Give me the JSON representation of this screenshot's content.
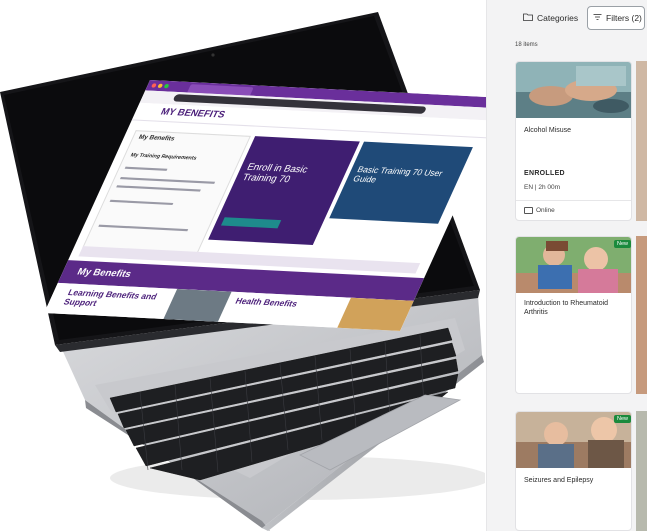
{
  "laptop_screen": {
    "page_title": "MY BENEFITS",
    "section_title": "My Benefits",
    "left_subtitle": "My Training Requirements",
    "card1_title": "Enroll in Basic Training 70",
    "card2_title": "Basic Training 70 User Guide",
    "band_title": "My Benefits",
    "bottom_left_title": "Learning Benefits and Support",
    "bottom_mid_title": "Health Benefits"
  },
  "toolbar": {
    "categories_label": "Categories",
    "filters_label": "Filters (2)",
    "categories_icon": "folder-icon",
    "filters_icon": "filter-icon"
  },
  "results": {
    "count_label": "18 items"
  },
  "courses": [
    {
      "title": "Alcohol Misuse",
      "status": "ENROLLED",
      "language": "EN",
      "duration": "2h 00m",
      "delivery": "Online",
      "is_new": false
    },
    {
      "title": "Introduction to Rheumatoid Arthritis",
      "badge": "New",
      "is_new": true
    },
    {
      "title": "Seizures and Epilepsy",
      "badge": "New",
      "is_new": true
    }
  ],
  "colors": {
    "accent_purple": "#5b2a88",
    "new_badge": "#1a8a3c",
    "panel_bg": "#f3f3f4"
  }
}
